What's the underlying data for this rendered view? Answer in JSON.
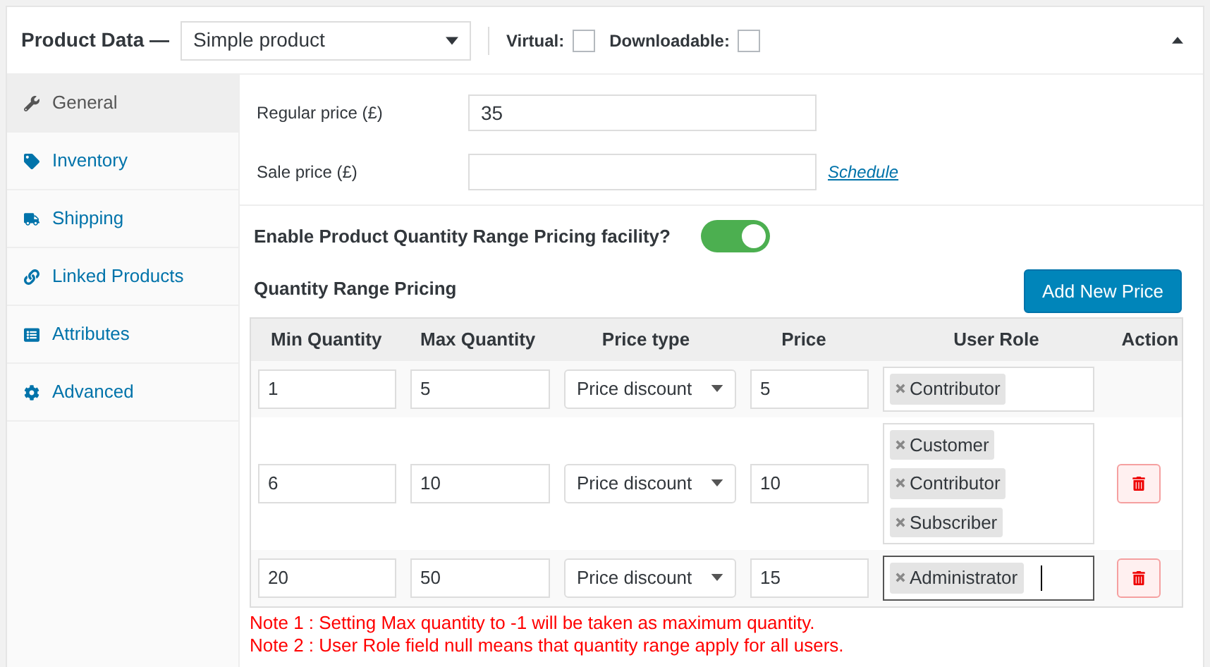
{
  "header": {
    "title": "Product Data —",
    "product_type": "Simple product",
    "options": [
      {
        "label": "Virtual:",
        "checked": false
      },
      {
        "label": "Downloadable:",
        "checked": false
      }
    ],
    "expanded": true
  },
  "sidebar": {
    "items": [
      {
        "label": "General",
        "selected": true
      },
      {
        "label": "Inventory",
        "selected": false
      },
      {
        "label": "Shipping",
        "selected": false
      },
      {
        "label": "Linked Products",
        "selected": false
      },
      {
        "label": "Attributes",
        "selected": false
      },
      {
        "label": "Advanced",
        "selected": false
      }
    ]
  },
  "general": {
    "regular_price": {
      "label": "Regular price (£)",
      "value": "35"
    },
    "sale_price": {
      "label": "Sale price (£)",
      "link": "Schedule"
    },
    "enable": {
      "label": "Enable Product Quantity Range Pricing facility?",
      "on": true
    },
    "section_title": "Quantity Range Pricing",
    "add_button": "Add New Price",
    "table": {
      "columns": [
        "Min Quantity",
        "Max Quantity",
        "Price type",
        "Price",
        "User Role",
        "Action"
      ],
      "rows": [
        {
          "min": "1",
          "max": "5",
          "price_type": "Price discount",
          "price": "5",
          "roles": [
            "Contributor"
          ],
          "deletable": false,
          "focused": false
        },
        {
          "min": "6",
          "max": "10",
          "price_type": "Price discount",
          "price": "10",
          "roles": [
            "Customer",
            "Contributor",
            "Subscriber"
          ],
          "deletable": true,
          "focused": false
        },
        {
          "min": "20",
          "max": "50",
          "price_type": "Price discount",
          "price": "15",
          "roles": [
            "Administrator"
          ],
          "deletable": true,
          "focused": true
        }
      ]
    },
    "notes": [
      "Note 1 : Setting Max quantity to -1 will be taken as maximum quantity.",
      "Note 2 : User Role field null means that quantity range apply for all users."
    ]
  }
}
